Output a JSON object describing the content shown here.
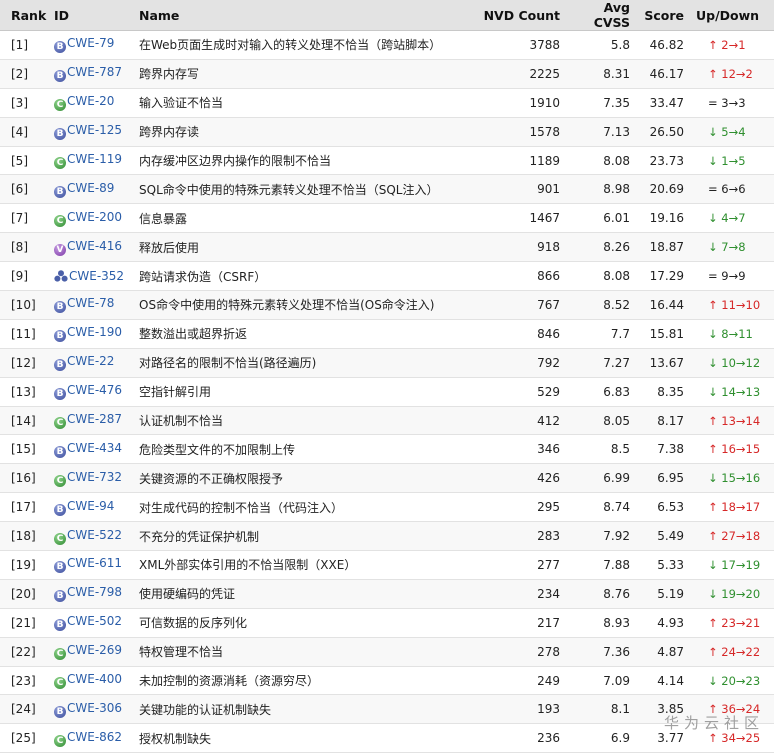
{
  "table": {
    "headers": {
      "rank": "Rank",
      "id": "ID",
      "name": "Name",
      "nvd": "NVD Count",
      "cvss": "Avg CVSS",
      "score": "Score",
      "updown": "Up/Down"
    },
    "rows": [
      {
        "rank": "[1]",
        "icon": "B",
        "id": "CWE-79",
        "name": "在Web页面生成时对输入的转义处理不恰当（跨站脚本）",
        "nvd": "3788",
        "cvss": "5.8",
        "score": "46.82",
        "ud": "↑ 2→1",
        "dir": "up"
      },
      {
        "rank": "[2]",
        "icon": "B",
        "id": "CWE-787",
        "name": "跨界内存写",
        "nvd": "2225",
        "cvss": "8.31",
        "score": "46.17",
        "ud": "↑ 12→2",
        "dir": "up"
      },
      {
        "rank": "[3]",
        "icon": "C",
        "id": "CWE-20",
        "name": "输入验证不恰当",
        "nvd": "1910",
        "cvss": "7.35",
        "score": "33.47",
        "ud": "= 3→3",
        "dir": "same"
      },
      {
        "rank": "[4]",
        "icon": "B",
        "id": "CWE-125",
        "name": "跨界内存读",
        "nvd": "1578",
        "cvss": "7.13",
        "score": "26.50",
        "ud": "↓ 5→4",
        "dir": "down"
      },
      {
        "rank": "[5]",
        "icon": "C",
        "id": "CWE-119",
        "name": "内存缓冲区边界内操作的限制不恰当",
        "nvd": "1189",
        "cvss": "8.08",
        "score": "23.73",
        "ud": "↓ 1→5",
        "dir": "down"
      },
      {
        "rank": "[6]",
        "icon": "B",
        "id": "CWE-89",
        "name": "SQL命令中使用的特殊元素转义处理不恰当（SQL注入）",
        "nvd": "901",
        "cvss": "8.98",
        "score": "20.69",
        "ud": "= 6→6",
        "dir": "same"
      },
      {
        "rank": "[7]",
        "icon": "C",
        "id": "CWE-200",
        "name": "信息暴露",
        "nvd": "1467",
        "cvss": "6.01",
        "score": "19.16",
        "ud": "↓ 4→7",
        "dir": "down"
      },
      {
        "rank": "[8]",
        "icon": "V",
        "id": "CWE-416",
        "name": "释放后使用",
        "nvd": "918",
        "cvss": "8.26",
        "score": "18.87",
        "ud": "↓ 7→8",
        "dir": "down"
      },
      {
        "rank": "[9]",
        "icon": "cat",
        "id": "CWE-352",
        "name": "跨站请求伪造（CSRF）",
        "nvd": "866",
        "cvss": "8.08",
        "score": "17.29",
        "ud": "= 9→9",
        "dir": "same"
      },
      {
        "rank": "[10]",
        "icon": "B",
        "id": "CWE-78",
        "name": "OS命令中使用的特殊元素转义处理不恰当(OS命令注入)",
        "nvd": "767",
        "cvss": "8.52",
        "score": "16.44",
        "ud": "↑ 11→10",
        "dir": "up"
      },
      {
        "rank": "[11]",
        "icon": "B",
        "id": "CWE-190",
        "name": "整数溢出或超界折返",
        "nvd": "846",
        "cvss": "7.7",
        "score": "15.81",
        "ud": "↓ 8→11",
        "dir": "down"
      },
      {
        "rank": "[12]",
        "icon": "B",
        "id": "CWE-22",
        "name": "对路径名的限制不恰当(路径遍历)",
        "nvd": "792",
        "cvss": "7.27",
        "score": "13.67",
        "ud": "↓ 10→12",
        "dir": "down"
      },
      {
        "rank": "[13]",
        "icon": "B",
        "id": "CWE-476",
        "name": "空指针解引用",
        "nvd": "529",
        "cvss": "6.83",
        "score": "8.35",
        "ud": "↓ 14→13",
        "dir": "down"
      },
      {
        "rank": "[14]",
        "icon": "C",
        "id": "CWE-287",
        "name": "认证机制不恰当",
        "nvd": "412",
        "cvss": "8.05",
        "score": "8.17",
        "ud": "↑ 13→14",
        "dir": "up"
      },
      {
        "rank": "[15]",
        "icon": "B",
        "id": "CWE-434",
        "name": "危险类型文件的不加限制上传",
        "nvd": "346",
        "cvss": "8.5",
        "score": "7.38",
        "ud": "↑ 16→15",
        "dir": "up"
      },
      {
        "rank": "[16]",
        "icon": "C",
        "id": "CWE-732",
        "name": "关键资源的不正确权限授予",
        "nvd": "426",
        "cvss": "6.99",
        "score": "6.95",
        "ud": "↓ 15→16",
        "dir": "down"
      },
      {
        "rank": "[17]",
        "icon": "B",
        "id": "CWE-94",
        "name": "对生成代码的控制不恰当（代码注入）",
        "nvd": "295",
        "cvss": "8.74",
        "score": "6.53",
        "ud": "↑ 18→17",
        "dir": "up"
      },
      {
        "rank": "[18]",
        "icon": "C",
        "id": "CWE-522",
        "name": "不充分的凭证保护机制",
        "nvd": "283",
        "cvss": "7.92",
        "score": "5.49",
        "ud": "↑ 27→18",
        "dir": "up"
      },
      {
        "rank": "[19]",
        "icon": "B",
        "id": "CWE-611",
        "name": "XML外部实体引用的不恰当限制（XXE）",
        "nvd": "277",
        "cvss": "7.88",
        "score": "5.33",
        "ud": "↓ 17→19",
        "dir": "down"
      },
      {
        "rank": "[20]",
        "icon": "B",
        "id": "CWE-798",
        "name": "使用硬编码的凭证",
        "nvd": "234",
        "cvss": "8.76",
        "score": "5.19",
        "ud": "↓ 19→20",
        "dir": "down"
      },
      {
        "rank": "[21]",
        "icon": "B",
        "id": "CWE-502",
        "name": "可信数据的反序列化",
        "nvd": "217",
        "cvss": "8.93",
        "score": "4.93",
        "ud": "↑ 23→21",
        "dir": "up"
      },
      {
        "rank": "[22]",
        "icon": "C",
        "id": "CWE-269",
        "name": "特权管理不恰当",
        "nvd": "278",
        "cvss": "7.36",
        "score": "4.87",
        "ud": "↑ 24→22",
        "dir": "up"
      },
      {
        "rank": "[23]",
        "icon": "C",
        "id": "CWE-400",
        "name": "未加控制的资源消耗（资源穷尽）",
        "nvd": "249",
        "cvss": "7.09",
        "score": "4.14",
        "ud": "↓ 20→23",
        "dir": "down"
      },
      {
        "rank": "[24]",
        "icon": "B",
        "id": "CWE-306",
        "name": "关键功能的认证机制缺失",
        "nvd": "193",
        "cvss": "8.1",
        "score": "3.85",
        "ud": "↑ 36→24",
        "dir": "up"
      },
      {
        "rank": "[25]",
        "icon": "C",
        "id": "CWE-862",
        "name": "授权机制缺失",
        "nvd": "236",
        "cvss": "6.9",
        "score": "3.77",
        "ud": "↑ 34→25",
        "dir": "up"
      }
    ]
  },
  "watermark": "华为云社区"
}
